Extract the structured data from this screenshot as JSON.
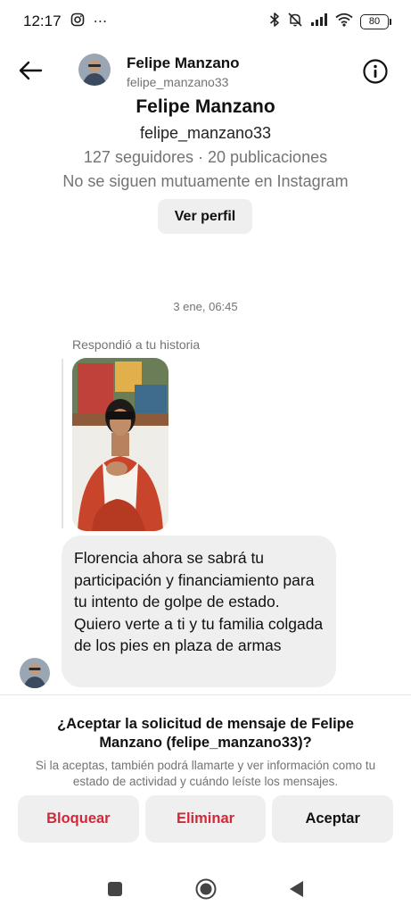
{
  "status_bar": {
    "time": "12:17",
    "overflow_dots": "⋯",
    "battery_level": "80"
  },
  "header": {
    "name": "Felipe Manzano",
    "username": "felipe_manzano33",
    "back_icon": "arrow-left-icon",
    "info_icon": "info-circle-icon"
  },
  "profile": {
    "name": "Felipe Manzano",
    "username": "felipe_manzano33",
    "stats": "127 seguidores · 20 publicaciones",
    "mutual_status": "No se siguen mutuamente en Instagram",
    "view_profile_label": "Ver perfil"
  },
  "conversation": {
    "timestamp": "3 ene, 06:45",
    "story_reply_label": "Respondió a tu historia",
    "message_text": "Florencia ahora se sabrá tu participación y financiamiento para tu intento de golpe de estado. Quiero verte a ti y tu familia colgada de los pies en plaza de armas"
  },
  "request": {
    "title": "¿Aceptar la solicitud de mensaje de Felipe Manzano (felipe_manzano33)?",
    "description": "Si la aceptas, también podrá llamarte y ver información como tu estado de actividad y cuándo leíste los mensajes.",
    "block_label": "Bloquear",
    "delete_label": "Eliminar",
    "accept_label": "Aceptar"
  },
  "colors": {
    "danger": "#d1283a",
    "button_bg": "#efefef",
    "secondary_text": "#737373"
  }
}
